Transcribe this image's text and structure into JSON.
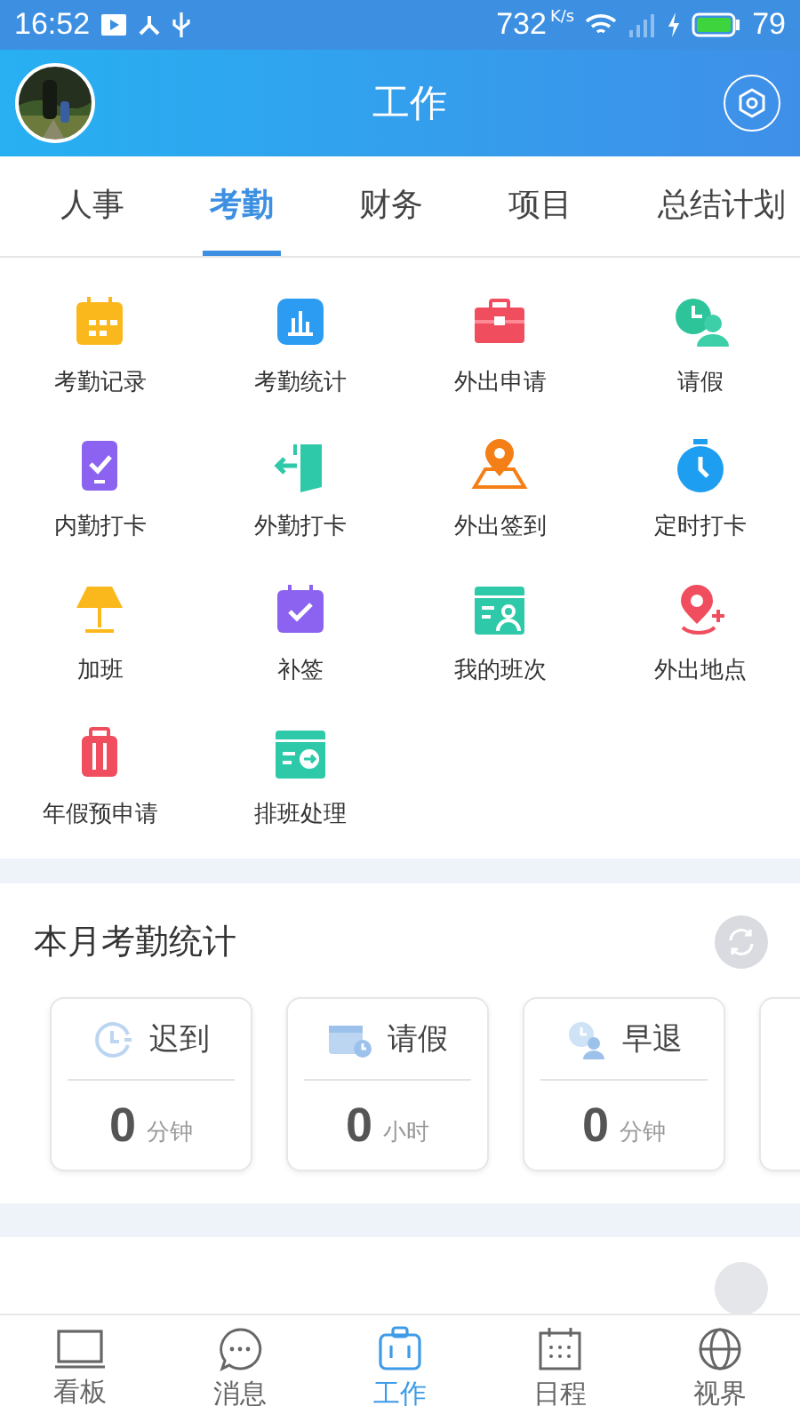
{
  "status_bar": {
    "time": "16:52",
    "speed": "732",
    "speed_unit": "K/s",
    "battery": "79"
  },
  "header": {
    "title": "工作"
  },
  "tabs": [
    {
      "label": "人事",
      "selected": false
    },
    {
      "label": "考勤",
      "selected": true
    },
    {
      "label": "财务",
      "selected": false
    },
    {
      "label": "项目",
      "selected": false
    },
    {
      "label": "总结计划",
      "selected": false
    }
  ],
  "features": [
    {
      "label": "考勤记录"
    },
    {
      "label": "考勤统计"
    },
    {
      "label": "外出申请"
    },
    {
      "label": "请假"
    },
    {
      "label": "内勤打卡"
    },
    {
      "label": "外勤打卡"
    },
    {
      "label": "外出签到"
    },
    {
      "label": "定时打卡"
    },
    {
      "label": "加班"
    },
    {
      "label": "补签"
    },
    {
      "label": "我的班次"
    },
    {
      "label": "外出地点"
    },
    {
      "label": "年假预申请"
    },
    {
      "label": "排班处理"
    }
  ],
  "monthly_stats": {
    "title": "本月考勤统计",
    "cards": [
      {
        "label": "迟到",
        "value": "0",
        "unit": "分钟"
      },
      {
        "label": "请假",
        "value": "0",
        "unit": "小时"
      },
      {
        "label": "早退",
        "value": "0",
        "unit": "分钟"
      }
    ]
  },
  "bottom_nav": [
    {
      "label": "看板",
      "selected": false
    },
    {
      "label": "消息",
      "selected": false
    },
    {
      "label": "工作",
      "selected": true
    },
    {
      "label": "日程",
      "selected": false
    },
    {
      "label": "视界",
      "selected": false
    }
  ]
}
